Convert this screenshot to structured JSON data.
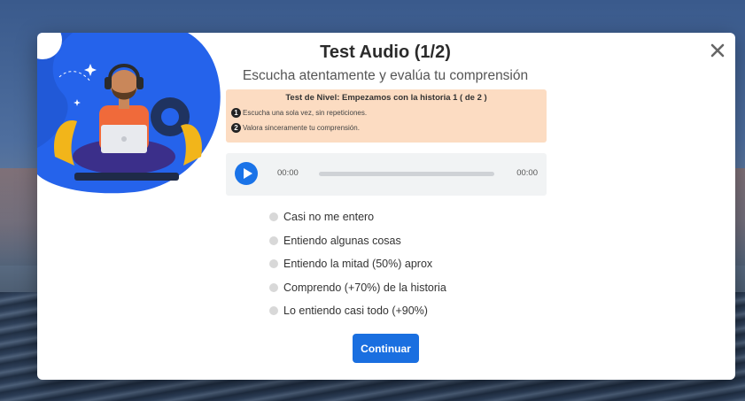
{
  "modal": {
    "title": "Test Audio (1/2)",
    "subtitle": "Escucha atentamente y evalúa tu comprensión",
    "close_icon": "close-icon"
  },
  "info": {
    "title": "Test de Nivel: Empezamos con la historia 1 ( de 2 )",
    "steps": [
      {
        "num": "1",
        "text": "Escucha una sola vez, sin repeticiones."
      },
      {
        "num": "2",
        "text": "Valora sinceramente tu comprensión."
      }
    ],
    "background_color": "#fcdcc2"
  },
  "player": {
    "current_time": "00:00",
    "duration": "00:00",
    "progress": 0,
    "play_icon": "play-icon",
    "accent_color": "#1a73e8"
  },
  "options": [
    "Casi no me entero",
    "Entiendo algunas cosas",
    "Entiendo la mitad (50%) aprox",
    "Comprendo (+70%) de la historia",
    "Lo entiendo casi todo (+90%)"
  ],
  "continue_label": "Continuar",
  "colors": {
    "primary": "#1a6fe0",
    "illustration_blue": "#2563eb",
    "shirt": "#f06a3a"
  }
}
